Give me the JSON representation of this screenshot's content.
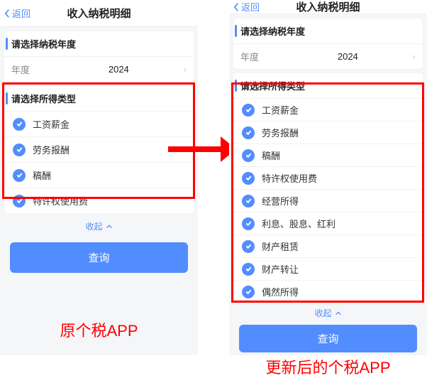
{
  "nav": {
    "back_label": "返回",
    "title": "收入纳税明细"
  },
  "year_section": {
    "title": "请选择纳税年度",
    "label": "年度",
    "value": "2024"
  },
  "income_section": {
    "title": "请选择所得类型"
  },
  "collapse_label": "收起",
  "query_btn": "查询",
  "left": {
    "caption": "原个税APP",
    "options": [
      "工资薪金",
      "劳务报酬",
      "稿酬",
      "特许权使用费"
    ]
  },
  "right": {
    "caption": "更新后的个税APP",
    "options": [
      "工资薪金",
      "劳务报酬",
      "稿酬",
      "特许权使用费",
      "经营所得",
      "利息、股息、红利",
      "财产租赁",
      "财产转让",
      "偶然所得"
    ]
  }
}
